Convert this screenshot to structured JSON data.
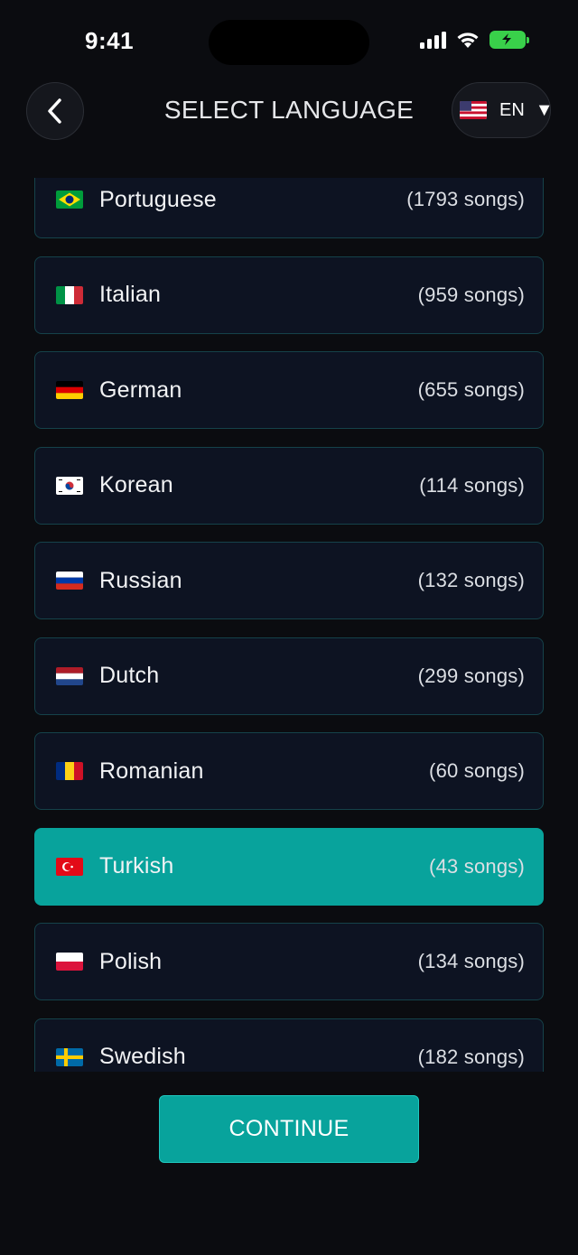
{
  "status_bar": {
    "time": "9:41"
  },
  "header": {
    "title": "SELECT LANGUAGE",
    "back_icon": "chevron-left-icon",
    "language_switch": {
      "code": "EN",
      "flag": "us",
      "caret_icon": "caret-down-icon"
    }
  },
  "languages": [
    {
      "name": "Portuguese",
      "count": "(1793 songs)",
      "flag": "br",
      "selected": false
    },
    {
      "name": "Italian",
      "count": "(959 songs)",
      "flag": "it",
      "selected": false
    },
    {
      "name": "German",
      "count": "(655 songs)",
      "flag": "de",
      "selected": false
    },
    {
      "name": "Korean",
      "count": "(114 songs)",
      "flag": "kr",
      "selected": false
    },
    {
      "name": "Russian",
      "count": "(132 songs)",
      "flag": "ru",
      "selected": false
    },
    {
      "name": "Dutch",
      "count": "(299 songs)",
      "flag": "nl",
      "selected": false
    },
    {
      "name": "Romanian",
      "count": "(60 songs)",
      "flag": "ro",
      "selected": false
    },
    {
      "name": "Turkish",
      "count": "(43 songs)",
      "flag": "tr",
      "selected": true
    },
    {
      "name": "Polish",
      "count": "(134 songs)",
      "flag": "pl",
      "selected": false
    },
    {
      "name": "Swedish",
      "count": "(182 songs)",
      "flag": "se",
      "selected": false
    }
  ],
  "continue_label": "CONTINUE",
  "colors": {
    "accent": "#08a39c",
    "row_bg": "#0d1322",
    "row_border": "#15424a",
    "background": "#0b0c10"
  }
}
